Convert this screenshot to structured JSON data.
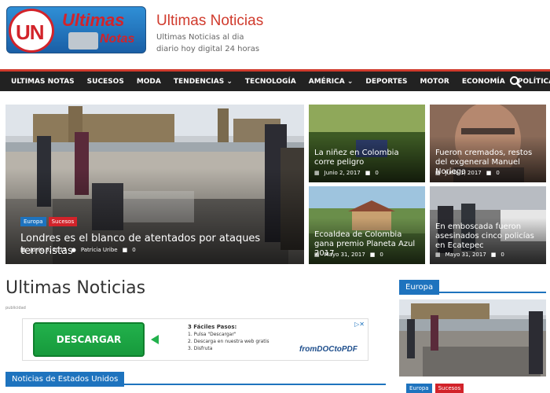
{
  "header": {
    "logo_un": "UN",
    "logo_word1": "Ultimas",
    "logo_word2": "Notas",
    "site_title": "Ultimas Noticias",
    "site_description": "Ultimas Noticias al dia diario hoy digital 24 horas"
  },
  "nav": {
    "items": [
      "ULTIMAS NOTAS",
      "SUCESOS",
      "MODA",
      "TENDENCIAS ⌄",
      "TECNOLOGÍA",
      "AMÉRICA ⌄",
      "DEPORTES",
      "MOTOR",
      "ECONOMÍA",
      "POLÍTICA"
    ]
  },
  "featured": {
    "main": {
      "badges": [
        "Europa",
        "Sucesos"
      ],
      "title": "Londres es el blanco de atentados por ataques terroristas",
      "date": "Junio 5, 2017",
      "author": "Patricia Uribe",
      "comments": "0"
    },
    "tiles": [
      {
        "title": "La niñez en Colombia corre peligro",
        "date": "Junio 2, 2017",
        "comments": "0"
      },
      {
        "title": "Fueron cremados, restos del exgeneral Manuel Noriega",
        "date": "Junio 1, 2017",
        "comments": "0"
      },
      {
        "title": "Ecoaldea de Colombia gana premio Planeta Azul 2017",
        "date": "Mayo 31, 2017",
        "comments": "0"
      },
      {
        "title": "En emboscada fueron asesinados cinco policías en Ecatepec",
        "date": "Mayo 31, 2017",
        "comments": "0"
      }
    ]
  },
  "main": {
    "title": "Ultimas Noticias",
    "publicidad": "publicidad",
    "ad": {
      "button": "DESCARGAR",
      "steps_title": "3 Fáciles Pasos:",
      "steps": [
        "1. Pulsa \"Descargar\"",
        "2. Descarga en nuestra web gratis",
        "3. Disfruta"
      ],
      "brand": "fromDOCtoPDF"
    },
    "section_title": "Noticias de Estados Unidos"
  },
  "sidebar": {
    "section_title": "Europa",
    "badges": [
      "Europa",
      "Sucesos"
    ]
  },
  "colors": {
    "accent": "#d03a2c",
    "blue": "#1e73be",
    "red_badge": "#d2232a",
    "nav_bg": "#222222"
  }
}
